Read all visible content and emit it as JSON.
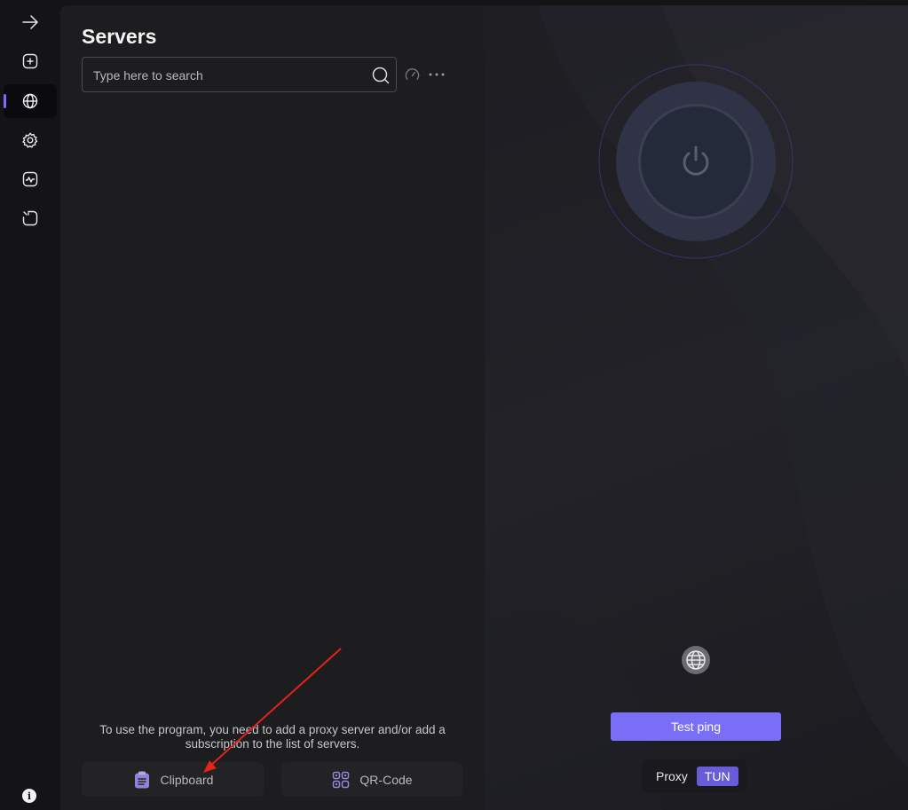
{
  "sidebar": {
    "items": [
      {
        "icon": "arrow-right-icon"
      },
      {
        "icon": "plus-square-icon"
      },
      {
        "icon": "globe-icon",
        "active": true
      },
      {
        "icon": "gear-icon"
      },
      {
        "icon": "activity-chart-icon"
      },
      {
        "icon": "import-icon"
      }
    ],
    "info_label": "i"
  },
  "servers": {
    "title": "Servers",
    "search_placeholder": "Type here to search",
    "hint": "To use the program, you need to add a proxy server and/or add a subscription to the list of servers.",
    "buttons": {
      "clipboard_label": "Clipboard",
      "qr_label": "QR-Code"
    }
  },
  "connection": {
    "test_ping_label": "Test ping",
    "mode": {
      "proxy_label": "Proxy",
      "tun_label": "TUN",
      "selected": "TUN"
    }
  },
  "colors": {
    "accent": "#7b6ef6",
    "annotation_arrow": "#e3241b"
  }
}
